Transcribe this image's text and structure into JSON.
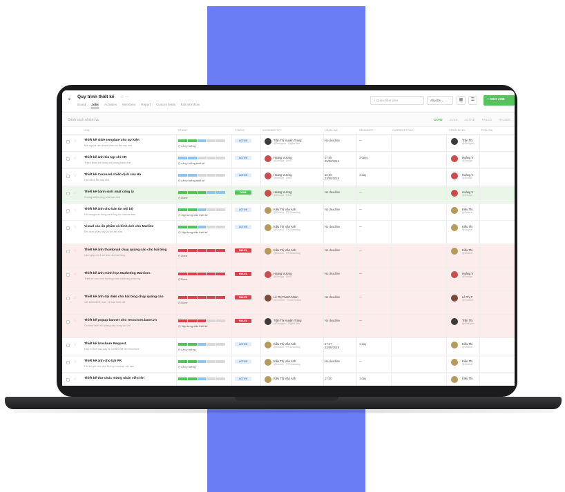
{
  "colors": {
    "accent": "#6b7df5",
    "green": "#55c25b",
    "blue": "#8ec3f0",
    "red": "#d9434c",
    "grey": "#d8d8d8"
  },
  "header": {
    "title": "Quy trình thiết kế",
    "tabs": [
      "Board",
      "Jobs",
      "Activities",
      "Members",
      "Report",
      "Custom fields",
      "Edit workflow"
    ],
    "search_placeholder": "Quick filter jobs",
    "filter_select": "All jobs",
    "add_button": "+ ADD JOB"
  },
  "subheader": {
    "title": "Danh sách nhiệm vụ",
    "filters": [
      "DONE",
      "OVER",
      "ACTIVE",
      "FAILED",
      "PAUSED"
    ]
  },
  "columns": [
    "JOB",
    "STAGE",
    "STATUS",
    "ASSIGNED TO",
    "DEADLINE",
    "REMAINED",
    "CURRENT TODO",
    "CREATED BY",
    "FOLLOW"
  ],
  "rows": [
    {
      "name": "Thiết kế slide template cho sự kiện",
      "desc": "Mọi người nên tham khảo bộ file này nhé",
      "stage_label": "Lên ý tưởng",
      "bar": [
        "g",
        "g",
        "b",
        "x",
        "x"
      ],
      "status": "ACTIVE",
      "assignee": "Trần Thị Huyền Trang",
      "assignee_sub": "@Designer · Digital Mkt",
      "deadline": "No deadline",
      "deadline2": "",
      "remain": "—",
      "owner": "Trần Thị",
      "owner_sub": "@Designer",
      "tone": "",
      "av": "#3b3b3b"
    },
    {
      "name": "Thiết kế ảnh bìa tạp chí HR",
      "desc": "Tham khảo nội dung và phong cách ảnh",
      "stage_label": "Lên ý tưởng thiết kế",
      "bar": [
        "b",
        "b",
        "x",
        "x",
        "x"
      ],
      "status": "ACTIVE",
      "assignee": "Hoàng Vương",
      "assignee_sub": "@Design · DMO",
      "deadline": "07:59",
      "deadline2": "25/08/2019",
      "remain": "3 days",
      "owner": "Hoàng V",
      "owner_sub": "@Design",
      "tone": "",
      "av": "#c94d4d"
    },
    {
      "name": "Thiết kế Carousel chiến dịch của Hà",
      "desc": "Hà check file này nhé",
      "stage_label": "Lên ý tưởng thiết kế",
      "bar": [
        "b",
        "b",
        "x",
        "x",
        "x"
      ],
      "status": "ACTIVE",
      "assignee": "Hoàng Vương",
      "assignee_sub": "@Design · DMO",
      "deadline": "16:59",
      "deadline2": "23/08/2019",
      "remain": "1 day",
      "owner": "Hoàng V",
      "owner_sub": "@Design",
      "tone": "",
      "av": "#c94d4d"
    },
    {
      "name": "Thiết kế bánh sinh nhật công ty",
      "desc": "Không biết tưởng cửa bạn nhé",
      "stage_label": "Done",
      "bar": [
        "g",
        "g",
        "g",
        "b",
        "b"
      ],
      "status": "DONE",
      "assignee": "Hoàng Vương",
      "assignee_sub": "@Design · DMO",
      "deadline": "No deadline",
      "deadline2": "",
      "remain": "—",
      "owner": "Hoàng V",
      "owner_sub": "@Design",
      "tone": "green",
      "av": "#c94d4d"
    },
    {
      "name": "Thiết kế ảnh cho bản tin nội bộ",
      "desc": "Nội dung nhu đang và thông tin của các bạn",
      "stage_label": "Xây dựng mẫu thiết kế",
      "bar": [
        "g",
        "g",
        "b",
        "x",
        "x"
      ],
      "status": "ACTIVE",
      "assignee": "Kiều Thị Vân Anh",
      "assignee_sub": "@Search · PR Branding",
      "deadline": "No deadline",
      "deadline2": "",
      "remain": "—",
      "owner": "Kiều Thị",
      "owner_sub": "@Search",
      "tone": "",
      "av": "#b59a5c"
    },
    {
      "name": "Visual các ấn phẩm và hình ảnh cho Marline",
      "desc": "Em xem phần này và chi tiết nhé",
      "stage_label": "Xây dựng mẫu thiết kế",
      "bar": [
        "g",
        "g",
        "b",
        "x",
        "x"
      ],
      "status": "ACTIVE",
      "assignee": "Kiều Thị Vân Anh",
      "assignee_sub": "@Search · PR Branding",
      "deadline": "No deadline",
      "deadline2": "",
      "remain": "—",
      "owner": "Kiều Thị",
      "owner_sub": "@Search",
      "tone": "",
      "av": "#b59a5c"
    },
    {
      "name": "Thiết kế ảnh thumbnail chạy quảng cáo cho bài blog",
      "desc": "Làm giúp chị 1 số ảnh cho bài blog",
      "stage_label": "Done",
      "bar": [
        "r",
        "r",
        "r",
        "r",
        "r"
      ],
      "status": "FAILED",
      "assignee": "Kiều Thị Vân Anh",
      "assignee_sub": "@Search · PR Branding",
      "deadline": "No deadline",
      "deadline2": "",
      "remain": "—",
      "owner": "Kiều Thị",
      "owner_sub": "@Search",
      "tone": "red",
      "av": "#b59a5c"
    },
    {
      "name": "Thiết kế ảnh minh họa Marketing Warriors",
      "desc": "Thiết kế các hình hướng nhân vật trong chương",
      "stage_label": "Done",
      "bar": [
        "r",
        "r",
        "r",
        "r",
        "r"
      ],
      "status": "FAILED",
      "assignee": "Hoàng Vương",
      "assignee_sub": "@Design · DMO",
      "deadline": "No deadline",
      "deadline2": "",
      "remain": "—",
      "owner": "Hoàng V",
      "owner_sub": "@Design",
      "tone": "red",
      "av": "#c94d4d"
    },
    {
      "name": "Thiết kế ảnh đại diện cho bài blog chạy quảng cáo",
      "desc": "với 1200x628, bạn, 16 loại hình vật",
      "stage_label": "Done",
      "bar": [
        "r",
        "r",
        "r",
        "r",
        "r"
      ],
      "status": "FAILED",
      "assignee": "Lê Thị Thanh Nhàn",
      "assignee_sub": "@Content · Social Media",
      "deadline": "No deadline",
      "deadline2": "",
      "remain": "—",
      "owner": "Lê Thị T",
      "owner_sub": "@Content",
      "tone": "red",
      "av": "#7a4a3a"
    },
    {
      "name": "Thiết kế popup banner cho resources.base.vn",
      "desc": "Content hiển thị quảng cáo cùng vòi với",
      "stage_label": "Xây dựng mẫu thiết kế",
      "bar": [
        "r",
        "r",
        "r",
        "x",
        "x"
      ],
      "status": "FAILED",
      "assignee": "Trần Thị Huyền Trang",
      "assignee_sub": "@Designer · Digital Mkt",
      "deadline": "No deadline",
      "deadline2": "",
      "remain": "—",
      "owner": "Trần Thị",
      "owner_sub": "@Designer",
      "tone": "red",
      "av": "#3b3b3b"
    },
    {
      "name": "Thiết kế brochure Request",
      "desc": "Hợp tri ảnh vào đây tạ content để làm brochure",
      "stage_label": "Lên ý tưởng",
      "bar": [
        "g",
        "g",
        "b",
        "x",
        "x"
      ],
      "status": "ACTIVE",
      "assignee": "Kiều Thị Vân Anh",
      "assignee_sub": "@Search · PR Branding",
      "deadline": "17:47",
      "deadline2": "22/08/2019",
      "remain": "1 day",
      "owner": "Kiều Thị",
      "owner_sub": "@Search",
      "tone": "",
      "av": "#b59a5c"
    },
    {
      "name": "Thiết kế ảnh cho bài PR",
      "desc": "Chỉ số gửi bền tlnh Mới gi mockup, xin nào",
      "stage_label": "Lên ý tưởng",
      "bar": [
        "g",
        "g",
        "b",
        "x",
        "x"
      ],
      "status": "ACTIVE",
      "assignee": "Kiều Thị Vân Anh",
      "assignee_sub": "@Search · PR Branding",
      "deadline": "No deadline",
      "deadline2": "",
      "remain": "—",
      "owner": "Kiều Thị",
      "owner_sub": "@Search",
      "tone": "",
      "av": "#b59a5c"
    },
    {
      "name": "Thiết kế thư chúc mừng nhân viên lên",
      "desc": "",
      "stage_label": "",
      "bar": [
        "g",
        "g",
        "b",
        "x",
        "x"
      ],
      "status": "ACTIVE",
      "assignee": "Kiều Thị Vân Anh",
      "assignee_sub": "",
      "deadline": "17:40",
      "deadline2": "",
      "remain": "1 day",
      "owner": "Kiều Thị",
      "owner_sub": "",
      "tone": "",
      "av": "#b59a5c"
    }
  ]
}
